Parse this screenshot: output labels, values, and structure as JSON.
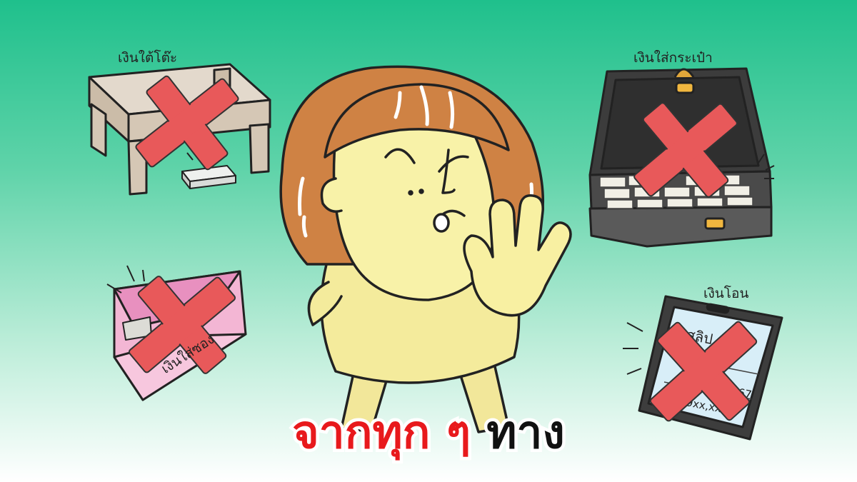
{
  "labels": {
    "table": "เงินใต้โต๊ะ",
    "briefcase": "เงินใส่กระเป๋า",
    "envelope": "เงินใส่ซอง",
    "transfer": "เงินโอน"
  },
  "caption": {
    "red_part": "จากทุก ๆ",
    "black_part": "ทาง"
  },
  "phone_slip": {
    "header": "สลิป",
    "date": "14 มค.67",
    "amount": "9xx,xxx.-"
  },
  "colors": {
    "bg_top": "#1fc08c",
    "bg_bottom": "#ffffff",
    "cross": "#e8595a",
    "caption_red": "#e8191c",
    "skin": "#f6ef9a",
    "hair": "#c97a3e"
  },
  "icons": [
    "table-icon",
    "briefcase-icon",
    "envelope-icon",
    "phone-icon",
    "cross-mark-icon",
    "girl-character"
  ]
}
